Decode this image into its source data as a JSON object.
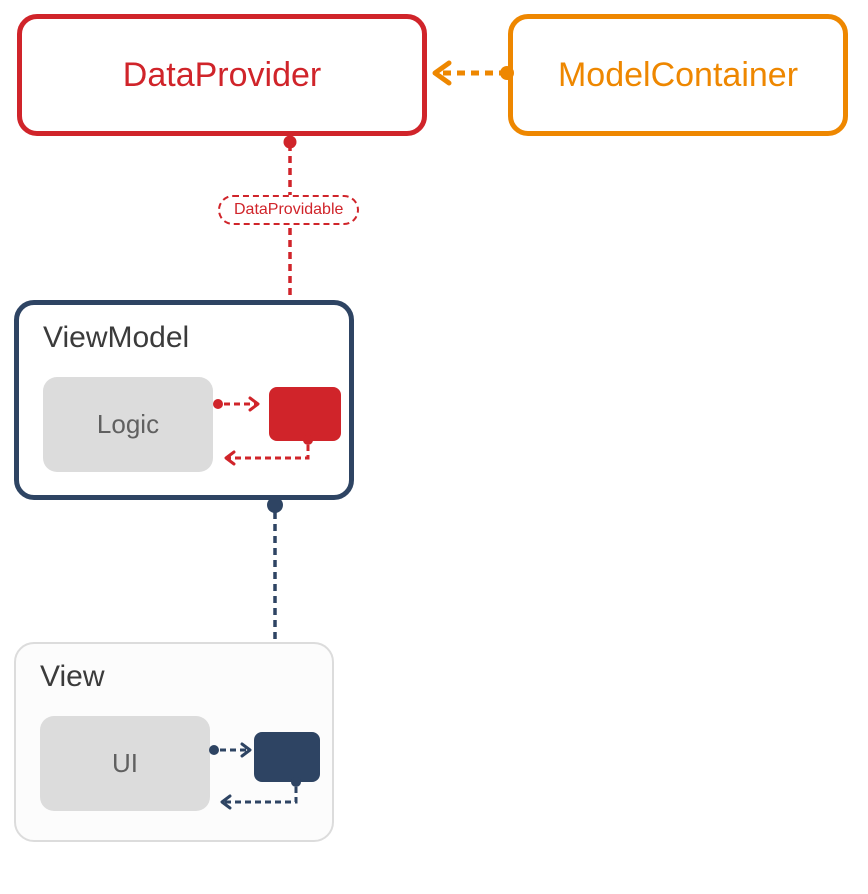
{
  "colors": {
    "red": "#d0242a",
    "orange": "#ee8700",
    "navy": "#2e4463",
    "gray": "#dcdcdc",
    "text_gray": "#606060"
  },
  "nodes": {
    "data_provider": {
      "label": "DataProvider"
    },
    "model_container": {
      "label": "ModelContainer"
    },
    "data_providable": {
      "label": "DataProvidable"
    },
    "view_model": {
      "label": "ViewModel",
      "inner": {
        "label": "Logic"
      }
    },
    "view": {
      "label": "View",
      "inner": {
        "label": "UI"
      }
    }
  },
  "relations": [
    {
      "from": "ModelContainer",
      "to": "DataProvider",
      "style": "dashed-arrow-ball",
      "color": "orange"
    },
    {
      "from": "DataProvider",
      "to": "ViewModel.port",
      "via": "DataProvidable",
      "style": "dashed-arrow-ball",
      "color": "red"
    },
    {
      "from": "ViewModel.Logic",
      "to": "ViewModel.port",
      "style": "dashed-arrow-ball-return",
      "color": "red"
    },
    {
      "from": "ViewModel",
      "to": "View.port",
      "style": "dashed-arrow-ball",
      "color": "navy"
    },
    {
      "from": "View.UI",
      "to": "View.port",
      "style": "dashed-arrow-ball-return",
      "color": "navy"
    }
  ]
}
